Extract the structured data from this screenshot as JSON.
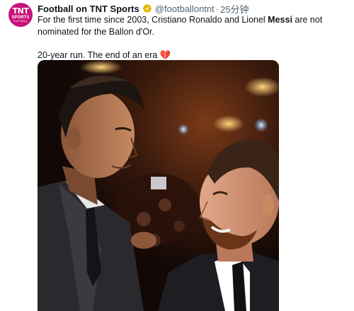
{
  "account": {
    "avatar_line1": "TNT",
    "avatar_line2": "SPORTS",
    "avatar_line3": "FOOTBALL",
    "display_name": "Football on TNT Sports",
    "handle": "@footballontnt",
    "separator": "·",
    "timestamp": "25分钟",
    "verified_icon": "verified-badge-icon",
    "badge_color": "#e8b600"
  },
  "tweet": {
    "line1_before": "For the first time since 2003, Cristiano Ronaldo and Lionel ",
    "line1_bold": "Messi",
    "line1_after": " are not nominated for the Ballon d'Or.",
    "line2": "20-year run. The end of an era ",
    "emoji": "💔",
    "emoji_icon": "broken-heart-icon"
  },
  "media": {
    "description_icon": "photo-ronaldo-messi"
  }
}
